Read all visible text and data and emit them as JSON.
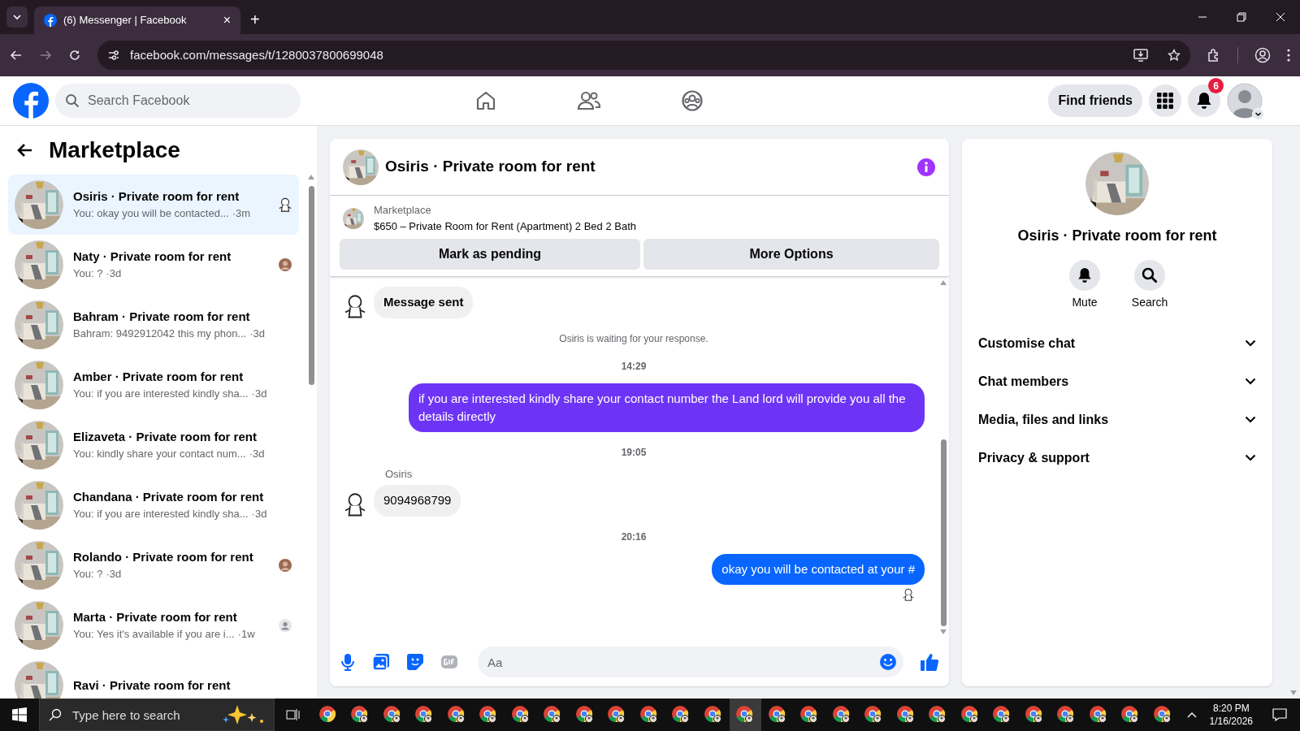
{
  "browser": {
    "tab_title": "(6) Messenger | Facebook",
    "tab_close": "×",
    "new_tab": "+",
    "url": "facebook.com/messages/t/1280037800699048"
  },
  "header": {
    "search_placeholder": "Search Facebook",
    "find_friends": "Find friends",
    "notification_count": "6"
  },
  "sidebar": {
    "title": "Marketplace",
    "conversations": [
      {
        "name": "Osiris · Private room for rent",
        "preview": "You: okay you will be contacted...",
        "time": "·3m",
        "kind": "sticker_receipt",
        "selected": true
      },
      {
        "name": "Naty · Private room for rent",
        "preview": "You: ?",
        "time": "·3d",
        "kind": "photo_receipt",
        "selected": false
      },
      {
        "name": "Bahram · Private room for rent",
        "preview": "Bahram: 9492912042 this my phon...",
        "time": "·3d",
        "kind": "plain",
        "selected": false
      },
      {
        "name": "Amber · Private room for rent",
        "preview": "You: if you are interested kindly sha...",
        "time": "·3d",
        "kind": "plain",
        "selected": false
      },
      {
        "name": "Elizaveta · Private room for rent",
        "preview": "You: kindly share your contact num...",
        "time": "·3d",
        "kind": "plain",
        "selected": false
      },
      {
        "name": "Chandana · Private room for rent",
        "preview": "You: if you are interested kindly sha...",
        "time": "·3d",
        "kind": "plain",
        "selected": false
      },
      {
        "name": "Rolando · Private room for rent",
        "preview": "You: ?",
        "time": "·3d",
        "kind": "photo_receipt",
        "selected": false
      },
      {
        "name": "Marta · Private room for rent",
        "preview": "You: Yes it's available if you are i...",
        "time": "·1w",
        "kind": "silhouette_receipt",
        "selected": false
      },
      {
        "name": "Ravi · Private room for rent",
        "kind": "plain",
        "selected": false
      }
    ]
  },
  "chat": {
    "title": "Osiris · Private room for rent",
    "listing_source": "Marketplace",
    "listing_title": "$650 – Private Room for Rent (Apartment) 2 Bed 2 Bath",
    "actions": [
      "Mark as pending",
      "More Options"
    ],
    "messages": [
      {
        "kind": "incoming",
        "text": "Message sent"
      },
      {
        "kind": "system",
        "text": "Osiris is waiting for your response."
      },
      {
        "kind": "time",
        "text": "14:29"
      },
      {
        "kind": "outgoing",
        "text": "if you are interested kindly share your contact number the Land lord will provide you all the details directly",
        "color": "#6e34f5",
        "seen": false
      },
      {
        "kind": "time",
        "text": "19:05"
      },
      {
        "kind": "incoming",
        "sender": "Osiris",
        "text": "9094968799"
      },
      {
        "kind": "time",
        "text": "20:16"
      },
      {
        "kind": "outgoing",
        "text": "okay you will be contacted at your #",
        "color": "#0866ff",
        "seen": true
      }
    ],
    "composer_placeholder": "Aa"
  },
  "details": {
    "title": "Osiris · Private room for rent",
    "actions": [
      "Mute",
      "Search"
    ],
    "sections": [
      {
        "label": "Customise chat",
        "expanded": false
      },
      {
        "label": "Chat members",
        "expanded": false
      },
      {
        "label": "Media, files and links",
        "expanded": false
      },
      {
        "label": "Privacy & support",
        "expanded": false
      }
    ]
  },
  "taskbar": {
    "search_placeholder": "Type here to search",
    "time": "8:20 PM",
    "date": "1/16/2026"
  }
}
